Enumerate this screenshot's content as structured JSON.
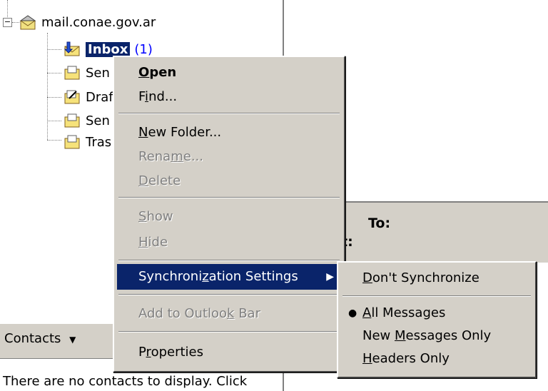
{
  "folder_tree": {
    "root_label": "mail.conae.gov.ar",
    "items": [
      {
        "label": "Inbox",
        "unread": "(1)"
      },
      {
        "label": "Sen"
      },
      {
        "label": "Draf"
      },
      {
        "label": "Sen"
      },
      {
        "label": "Tras"
      }
    ]
  },
  "preview": {
    "to_label": "To:",
    "second_label": "t:"
  },
  "contacts": {
    "header": "Contacts",
    "dropdown_glyph": "▼",
    "empty_text": "There are no contacts to display. Click"
  },
  "context_menu": {
    "open": {
      "pre": "",
      "key": "O",
      "post": "pen"
    },
    "find": {
      "pre": "F",
      "key": "i",
      "post": "nd..."
    },
    "new_folder": {
      "pre": "",
      "key": "N",
      "post": "ew Folder..."
    },
    "rename": {
      "pre": "Rena",
      "key": "m",
      "post": "e..."
    },
    "delete": {
      "pre": "",
      "key": "D",
      "post": "elete"
    },
    "show": {
      "pre": "",
      "key": "S",
      "post": "how"
    },
    "hide": {
      "pre": "",
      "key": "H",
      "post": "ide"
    },
    "sync": {
      "pre": "Synchroni",
      "key": "z",
      "post": "ation Settings"
    },
    "outlook_bar": {
      "pre": "Add to Outloo",
      "key": "k",
      "post": " Bar"
    },
    "properties": {
      "pre": "P",
      "key": "r",
      "post": "operties"
    },
    "submenu_arrow": "▶"
  },
  "sync_submenu": {
    "dont": {
      "pre": "",
      "key": "D",
      "post": "on't Synchronize"
    },
    "all": {
      "pre": "",
      "key": "A",
      "post": "ll Messages"
    },
    "new_only": {
      "pre": "New ",
      "key": "M",
      "post": "essages Only"
    },
    "headers": {
      "pre": "",
      "key": "H",
      "post": "eaders Only"
    },
    "selected_bullet": "●"
  },
  "colors": {
    "menu_bg": "#d4d0c8",
    "highlight": "#0a246a",
    "unread_count": "#0000ff"
  }
}
